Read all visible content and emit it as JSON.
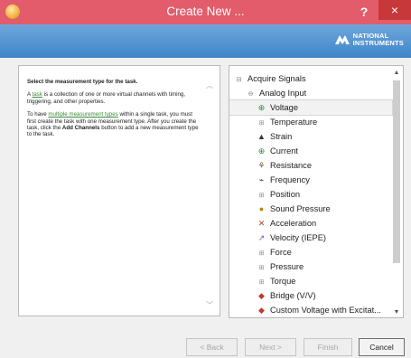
{
  "window": {
    "title": "Create New ...",
    "help_label": "?",
    "close_label": "×"
  },
  "branding": {
    "logo_line1": "NATIONAL",
    "logo_line2": "INSTRUMENTS"
  },
  "help_panel": {
    "heading": "Select the measurement type for the task.",
    "p1_pre": "A ",
    "p1_link": "task",
    "p1_post": " is a collection of one or more virtual channels with timing, triggering, and other properties.",
    "p2_pre": "To have ",
    "p2_link": "multiple measurement types",
    "p2_mid": " within a single task, you must first create the task with one measurement type. After you create the task, click the ",
    "p2_bold": "Add Channels",
    "p2_post": " button to add a new measurement type to the task."
  },
  "tree": {
    "root": "Acquire Signals",
    "group": "Analog Input",
    "items": [
      {
        "label": "Voltage",
        "icon": "voltage-icon",
        "expandable": false,
        "selected": true
      },
      {
        "label": "Temperature",
        "icon": "none",
        "expandable": true
      },
      {
        "label": "Strain",
        "icon": "strain-icon",
        "expandable": false
      },
      {
        "label": "Current",
        "icon": "current-icon",
        "expandable": false
      },
      {
        "label": "Resistance",
        "icon": "resistance-icon",
        "expandable": false
      },
      {
        "label": "Frequency",
        "icon": "frequency-icon",
        "expandable": false
      },
      {
        "label": "Position",
        "icon": "none",
        "expandable": true
      },
      {
        "label": "Sound Pressure",
        "icon": "sound-pressure-icon",
        "expandable": false
      },
      {
        "label": "Acceleration",
        "icon": "acceleration-icon",
        "expandable": false
      },
      {
        "label": "Velocity (IEPE)",
        "icon": "velocity-icon",
        "expandable": false
      },
      {
        "label": "Force",
        "icon": "none",
        "expandable": true
      },
      {
        "label": "Pressure",
        "icon": "none",
        "expandable": true
      },
      {
        "label": "Torque",
        "icon": "none",
        "expandable": true
      },
      {
        "label": "Bridge (V/V)",
        "icon": "bridge-icon",
        "expandable": false
      },
      {
        "label": "Custom Voltage with Excitat...",
        "icon": "custom-voltage-icon",
        "expandable": false
      }
    ]
  },
  "buttons": {
    "back": "< Back",
    "next": "Next >",
    "finish": "Finish",
    "cancel": "Cancel"
  },
  "colors": {
    "titlebar": "#e25c6b",
    "close": "#c7383b",
    "banner": "#4a8fd0"
  }
}
